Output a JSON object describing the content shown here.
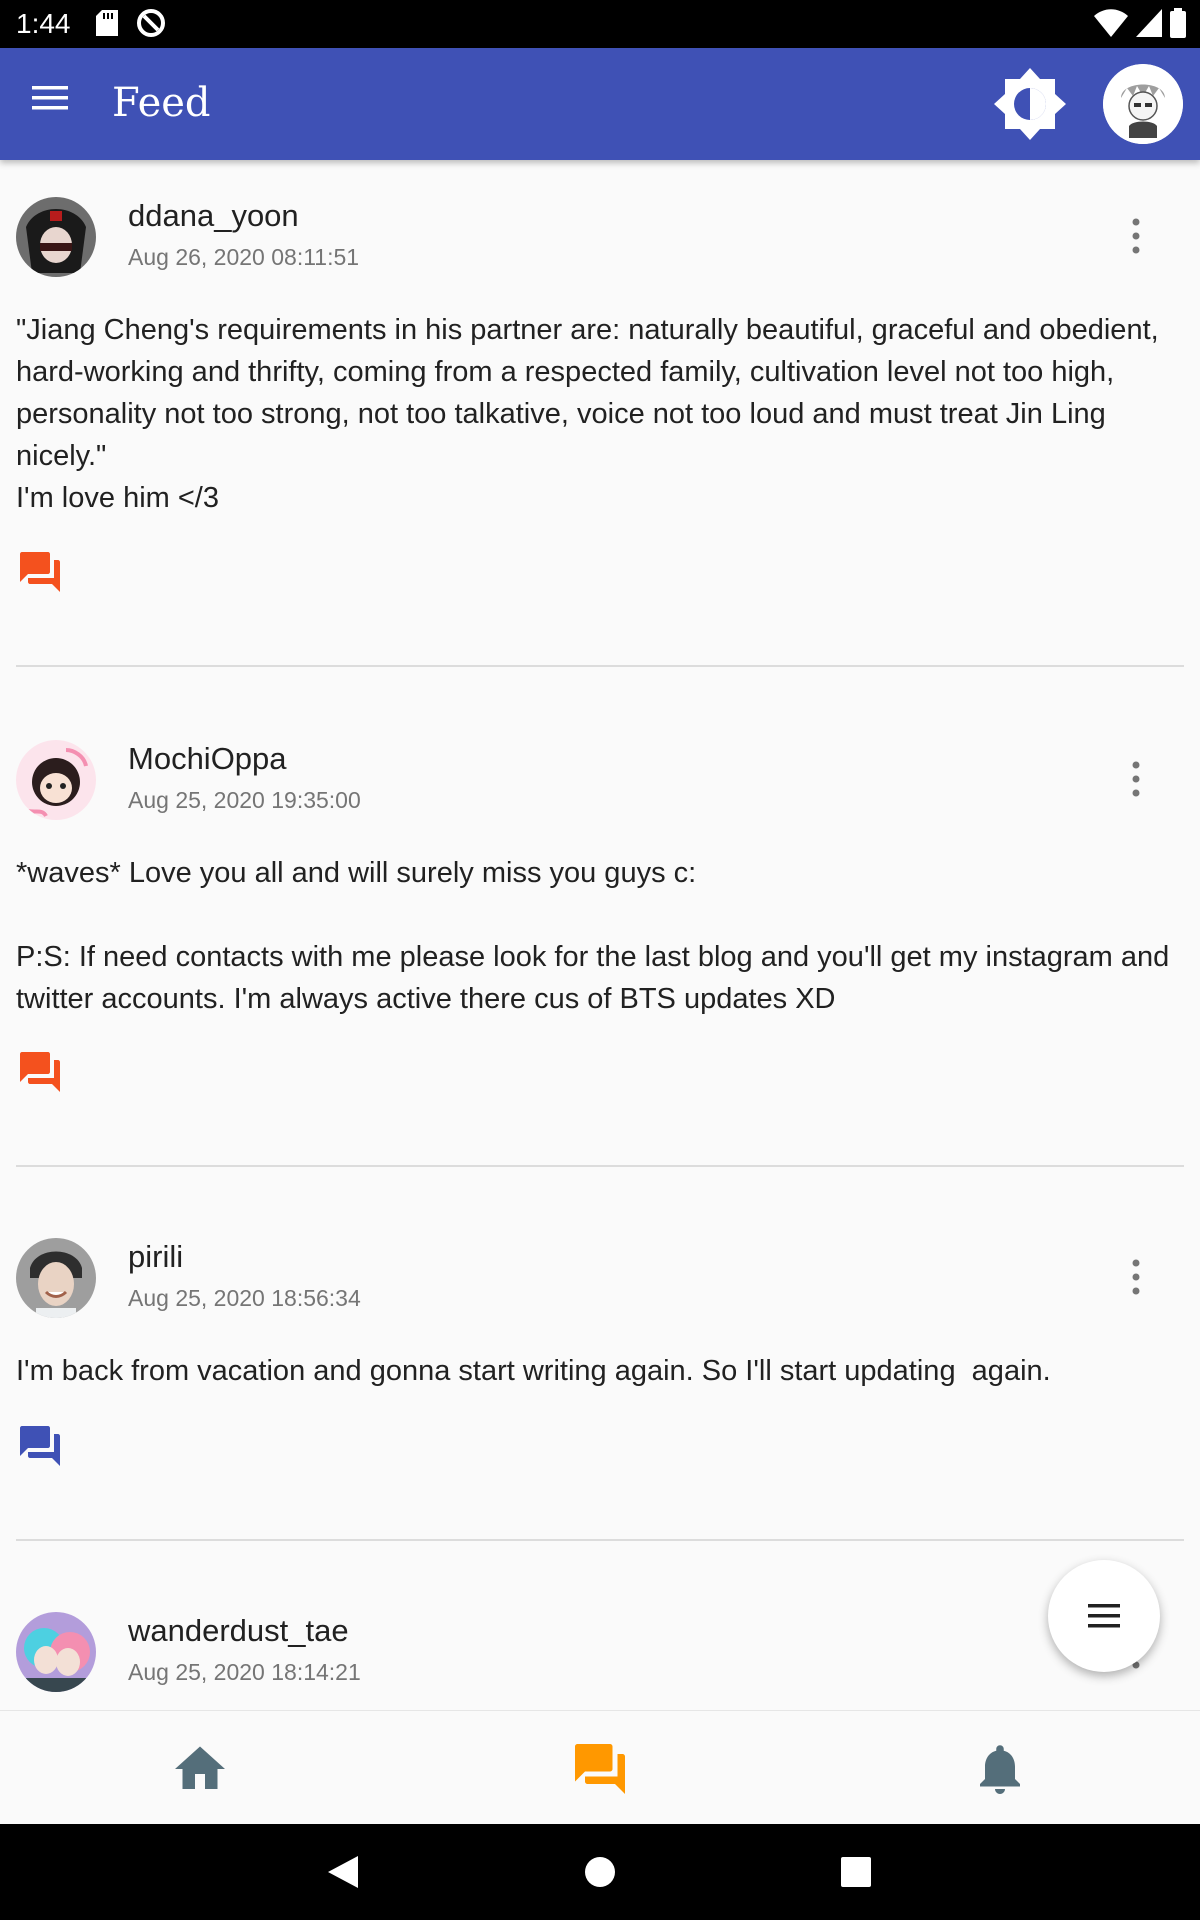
{
  "status_bar": {
    "time": "1:44"
  },
  "app_bar": {
    "title": "Feed",
    "icons": [
      "menu-icon",
      "brightness-icon",
      "profile-avatar"
    ],
    "color": "#3f51b5"
  },
  "posts": [
    {
      "username": "ddana_yoon",
      "timestamp": "Aug 26, 2020 08:11:51",
      "text": "\"Jiang Cheng's requirements in his partner are: naturally beautiful, graceful and obedient, hard-working and thrifty, coming from a respected family, cultivation level not too high, personality not too strong, not too talkative, voice not too loud and must treat Jin Ling nicely.\"\nI'm love him </3",
      "comment_icon_color": "#f4511e"
    },
    {
      "username": "MochiOppa",
      "timestamp": "Aug 25, 2020 19:35:00",
      "text": "*waves* Love you all and will surely miss you guys c:\n\nP:S: If need contacts with me please look for the last blog and you'll get my instagram and twitter accounts. I'm always active there cus of BTS updates XD",
      "comment_icon_color": "#f4511e"
    },
    {
      "username": "pirili",
      "timestamp": "Aug 25, 2020 18:56:34",
      "text": "I'm back from vacation and gonna start writing again. So I'll start updating  again.",
      "comment_icon_color": "#3f51b5"
    },
    {
      "username": "wanderdust_tae",
      "timestamp": "Aug 25, 2020 18:14:21",
      "text": "",
      "comment_icon_color": ""
    }
  ],
  "fab": {
    "icon": "list-icon"
  },
  "bottom_nav": {
    "tabs": [
      {
        "icon": "home-icon",
        "color": "#546e7a"
      },
      {
        "icon": "forum-icon",
        "color": "#ff9800",
        "active": true
      },
      {
        "icon": "bell-icon",
        "color": "#546e7a"
      }
    ]
  }
}
